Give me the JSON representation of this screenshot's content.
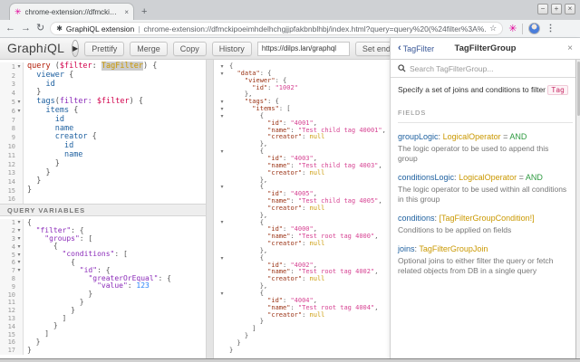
{
  "browser": {
    "tab": {
      "title": "chrome-extension://dfmckipoe",
      "close_icon": "×",
      "new_tab_icon": "+"
    },
    "window_controls": {
      "minimize": "−",
      "maximize": "+",
      "close": "×"
    },
    "nav": {
      "back_icon": "←",
      "forward_icon": "→",
      "reload_icon": "↻"
    },
    "omnibox": {
      "extension_name": "GraphiQL extension",
      "separator": "|",
      "url": "chrome-extension://dfmckipoeimhdelhchgjjpfakbnblhbj/index.html?query=query%20(%24filter%3A%...",
      "bookmark_star_icon": "☆",
      "extension_page_icon": "✱"
    },
    "extension_button_icon": "✳",
    "menu_icon": "⋮"
  },
  "toolbar": {
    "logo_graph": "Graph",
    "logo_i": "i",
    "logo_ql": "QL",
    "play_icon": "▶",
    "buttons": [
      "Prettify",
      "Merge",
      "Copy",
      "History"
    ],
    "endpoint_value": "https://dilps.lan/graphql",
    "set_endpoint_label": "Set endpoint"
  },
  "query_editor": {
    "lines": [
      {
        "n": 1,
        "f": 1,
        "t": [
          [
            "k",
            "query"
          ],
          [
            "pu",
            " ("
          ],
          [
            "v",
            "$filter"
          ],
          [
            "pu",
            ": "
          ],
          [
            "t sel",
            "TagFilter"
          ],
          [
            "pu",
            ") {"
          ]
        ]
      },
      {
        "n": 2,
        "t": [
          [
            "pu",
            "  "
          ],
          [
            "p",
            "viewer"
          ],
          [
            "pu",
            " {"
          ]
        ]
      },
      {
        "n": 3,
        "t": [
          [
            "pu",
            "    "
          ],
          [
            "p",
            "id"
          ]
        ]
      },
      {
        "n": 4,
        "t": [
          [
            "pu",
            "  }"
          ]
        ]
      },
      {
        "n": 5,
        "f": 1,
        "t": [
          [
            "pu",
            "  "
          ],
          [
            "p",
            "tags"
          ],
          [
            "pu",
            "("
          ],
          [
            "a",
            "filter:"
          ],
          [
            "pu",
            " "
          ],
          [
            "v",
            "$filter"
          ],
          [
            "pu",
            ") {"
          ]
        ]
      },
      {
        "n": 6,
        "f": 1,
        "t": [
          [
            "pu",
            "    "
          ],
          [
            "p",
            "items"
          ],
          [
            "pu",
            " {"
          ]
        ]
      },
      {
        "n": 7,
        "t": [
          [
            "pu",
            "      "
          ],
          [
            "p",
            "id"
          ]
        ]
      },
      {
        "n": 8,
        "t": [
          [
            "pu",
            "      "
          ],
          [
            "p",
            "name"
          ]
        ]
      },
      {
        "n": 9,
        "t": [
          [
            "pu",
            "      "
          ],
          [
            "p",
            "creator"
          ],
          [
            "pu",
            " {"
          ]
        ]
      },
      {
        "n": 10,
        "t": [
          [
            "pu",
            "        "
          ],
          [
            "p",
            "id"
          ]
        ]
      },
      {
        "n": 11,
        "t": [
          [
            "pu",
            "        "
          ],
          [
            "p",
            "name"
          ]
        ]
      },
      {
        "n": 12,
        "t": [
          [
            "pu",
            "      }"
          ]
        ]
      },
      {
        "n": 13,
        "t": [
          [
            "pu",
            "    }"
          ]
        ]
      },
      {
        "n": 14,
        "t": [
          [
            "pu",
            "  }"
          ]
        ]
      },
      {
        "n": 15,
        "t": [
          [
            "pu",
            "}"
          ]
        ]
      },
      {
        "n": 16,
        "t": []
      }
    ]
  },
  "variables_editor": {
    "header": "QUERY VARIABLES",
    "lines": [
      {
        "n": 1,
        "f": 1,
        "t": [
          [
            "pu",
            "{"
          ]
        ]
      },
      {
        "n": 2,
        "f": 1,
        "t": [
          [
            "pu",
            "  "
          ],
          [
            "vk",
            "\"filter\""
          ],
          [
            "pu",
            ": {"
          ]
        ]
      },
      {
        "n": 3,
        "f": 1,
        "t": [
          [
            "pu",
            "    "
          ],
          [
            "vk",
            "\"groups\""
          ],
          [
            "pu",
            ": ["
          ]
        ]
      },
      {
        "n": 4,
        "f": 1,
        "t": [
          [
            "pu",
            "      {"
          ]
        ]
      },
      {
        "n": 5,
        "f": 1,
        "t": [
          [
            "pu",
            "        "
          ],
          [
            "vk",
            "\"conditions\""
          ],
          [
            "pu",
            ": ["
          ]
        ]
      },
      {
        "n": 6,
        "f": 1,
        "t": [
          [
            "pu",
            "          {"
          ]
        ]
      },
      {
        "n": 7,
        "f": 1,
        "t": [
          [
            "pu",
            "            "
          ],
          [
            "vk",
            "\"id\""
          ],
          [
            "pu",
            ": {"
          ]
        ]
      },
      {
        "n": 8,
        "t": [
          [
            "pu",
            "              "
          ],
          [
            "vk",
            "\"greaterOrEqual\""
          ],
          [
            "pu",
            ": {"
          ]
        ]
      },
      {
        "n": 9,
        "t": [
          [
            "pu",
            "                "
          ],
          [
            "vk",
            "\"value\""
          ],
          [
            "pu",
            ": "
          ],
          [
            "num",
            "123"
          ]
        ]
      },
      {
        "n": 10,
        "t": [
          [
            "pu",
            "              }"
          ]
        ]
      },
      {
        "n": 11,
        "t": [
          [
            "pu",
            "            }"
          ]
        ]
      },
      {
        "n": 12,
        "t": [
          [
            "pu",
            "          }"
          ]
        ]
      },
      {
        "n": 13,
        "t": [
          [
            "pu",
            "        ]"
          ]
        ]
      },
      {
        "n": 14,
        "t": [
          [
            "pu",
            "      }"
          ]
        ]
      },
      {
        "n": 15,
        "t": [
          [
            "pu",
            "    ]"
          ]
        ]
      },
      {
        "n": 16,
        "t": [
          [
            "pu",
            "  }"
          ]
        ]
      },
      {
        "n": 17,
        "t": [
          [
            "pu",
            "}"
          ]
        ]
      }
    ]
  },
  "result_viewer": {
    "lines": [
      {
        "f": 1,
        "t": [
          [
            "pu",
            "{"
          ]
        ]
      },
      {
        "f": 1,
        "t": [
          [
            "pu",
            "  "
          ],
          [
            "rk",
            "\"data\""
          ],
          [
            "pu",
            ": {"
          ]
        ]
      },
      {
        "t": [
          [
            "pu",
            "    "
          ],
          [
            "rk",
            "\"viewer\""
          ],
          [
            "pu",
            ": {"
          ]
        ]
      },
      {
        "t": [
          [
            "pu",
            "      "
          ],
          [
            "rk",
            "\"id\""
          ],
          [
            "pu",
            ": "
          ],
          [
            "str",
            "\"1002\""
          ]
        ]
      },
      {
        "t": [
          [
            "pu",
            "    },"
          ]
        ]
      },
      {
        "f": 1,
        "t": [
          [
            "pu",
            "    "
          ],
          [
            "rk",
            "\"tags\""
          ],
          [
            "pu",
            ": {"
          ]
        ]
      },
      {
        "f": 1,
        "t": [
          [
            "pu",
            "      "
          ],
          [
            "rk",
            "\"items\""
          ],
          [
            "pu",
            ": ["
          ]
        ]
      },
      {
        "f": 1,
        "t": [
          [
            "pu",
            "        {"
          ]
        ]
      },
      {
        "t": [
          [
            "pu",
            "          "
          ],
          [
            "rk",
            "\"id\""
          ],
          [
            "pu",
            ": "
          ],
          [
            "str",
            "\"4001\""
          ],
          [
            "pu",
            ","
          ]
        ]
      },
      {
        "t": [
          [
            "pu",
            "          "
          ],
          [
            "rk",
            "\"name\""
          ],
          [
            "pu",
            ": "
          ],
          [
            "str",
            "\"Test child tag 40001\""
          ],
          [
            "pu",
            ","
          ]
        ]
      },
      {
        "t": [
          [
            "pu",
            "          "
          ],
          [
            "rk",
            "\"creator\""
          ],
          [
            "pu",
            ": "
          ],
          [
            "nul",
            "null"
          ]
        ]
      },
      {
        "t": [
          [
            "pu",
            "        },"
          ]
        ]
      },
      {
        "f": 1,
        "t": [
          [
            "pu",
            "        {"
          ]
        ]
      },
      {
        "t": [
          [
            "pu",
            "          "
          ],
          [
            "rk",
            "\"id\""
          ],
          [
            "pu",
            ": "
          ],
          [
            "str",
            "\"4003\""
          ],
          [
            "pu",
            ","
          ]
        ]
      },
      {
        "t": [
          [
            "pu",
            "          "
          ],
          [
            "rk",
            "\"name\""
          ],
          [
            "pu",
            ": "
          ],
          [
            "str",
            "\"Test child tag 4003\""
          ],
          [
            "pu",
            ","
          ]
        ]
      },
      {
        "t": [
          [
            "pu",
            "          "
          ],
          [
            "rk",
            "\"creator\""
          ],
          [
            "pu",
            ": "
          ],
          [
            "nul",
            "null"
          ]
        ]
      },
      {
        "t": [
          [
            "pu",
            "        },"
          ]
        ]
      },
      {
        "f": 1,
        "t": [
          [
            "pu",
            "        {"
          ]
        ]
      },
      {
        "t": [
          [
            "pu",
            "          "
          ],
          [
            "rk",
            "\"id\""
          ],
          [
            "pu",
            ": "
          ],
          [
            "str",
            "\"4005\""
          ],
          [
            "pu",
            ","
          ]
        ]
      },
      {
        "t": [
          [
            "pu",
            "          "
          ],
          [
            "rk",
            "\"name\""
          ],
          [
            "pu",
            ": "
          ],
          [
            "str",
            "\"Test child tag 4005\""
          ],
          [
            "pu",
            ","
          ]
        ]
      },
      {
        "t": [
          [
            "pu",
            "          "
          ],
          [
            "rk",
            "\"creator\""
          ],
          [
            "pu",
            ": "
          ],
          [
            "nul",
            "null"
          ]
        ]
      },
      {
        "t": [
          [
            "pu",
            "        },"
          ]
        ]
      },
      {
        "f": 1,
        "t": [
          [
            "pu",
            "        {"
          ]
        ]
      },
      {
        "t": [
          [
            "pu",
            "          "
          ],
          [
            "rk",
            "\"id\""
          ],
          [
            "pu",
            ": "
          ],
          [
            "str",
            "\"4000\""
          ],
          [
            "pu",
            ","
          ]
        ]
      },
      {
        "t": [
          [
            "pu",
            "          "
          ],
          [
            "rk",
            "\"name\""
          ],
          [
            "pu",
            ": "
          ],
          [
            "str",
            "\"Test root tag 4000\""
          ],
          [
            "pu",
            ","
          ]
        ]
      },
      {
        "t": [
          [
            "pu",
            "          "
          ],
          [
            "rk",
            "\"creator\""
          ],
          [
            "pu",
            ": "
          ],
          [
            "nul",
            "null"
          ]
        ]
      },
      {
        "t": [
          [
            "pu",
            "        },"
          ]
        ]
      },
      {
        "f": 1,
        "t": [
          [
            "pu",
            "        {"
          ]
        ]
      },
      {
        "t": [
          [
            "pu",
            "          "
          ],
          [
            "rk",
            "\"id\""
          ],
          [
            "pu",
            ": "
          ],
          [
            "str",
            "\"4002\""
          ],
          [
            "pu",
            ","
          ]
        ]
      },
      {
        "t": [
          [
            "pu",
            "          "
          ],
          [
            "rk",
            "\"name\""
          ],
          [
            "pu",
            ": "
          ],
          [
            "str",
            "\"Test root tag 4002\""
          ],
          [
            "pu",
            ","
          ]
        ]
      },
      {
        "t": [
          [
            "pu",
            "          "
          ],
          [
            "rk",
            "\"creator\""
          ],
          [
            "pu",
            ": "
          ],
          [
            "nul",
            "null"
          ]
        ]
      },
      {
        "t": [
          [
            "pu",
            "        },"
          ]
        ]
      },
      {
        "f": 1,
        "t": [
          [
            "pu",
            "        {"
          ]
        ]
      },
      {
        "t": [
          [
            "pu",
            "          "
          ],
          [
            "rk",
            "\"id\""
          ],
          [
            "pu",
            ": "
          ],
          [
            "str",
            "\"4004\""
          ],
          [
            "pu",
            ","
          ]
        ]
      },
      {
        "t": [
          [
            "pu",
            "          "
          ],
          [
            "rk",
            "\"name\""
          ],
          [
            "pu",
            ": "
          ],
          [
            "str",
            "\"Test root tag 4004\""
          ],
          [
            "pu",
            ","
          ]
        ]
      },
      {
        "t": [
          [
            "pu",
            "          "
          ],
          [
            "rk",
            "\"creator\""
          ],
          [
            "pu",
            ": "
          ],
          [
            "nul",
            "null"
          ]
        ]
      },
      {
        "t": [
          [
            "pu",
            "        }"
          ]
        ]
      },
      {
        "t": [
          [
            "pu",
            "      ]"
          ]
        ]
      },
      {
        "t": [
          [
            "pu",
            "    }"
          ]
        ]
      },
      {
        "t": [
          [
            "pu",
            "  }"
          ]
        ]
      },
      {
        "t": [
          [
            "pu",
            "}"
          ]
        ]
      }
    ]
  },
  "docs": {
    "back_label": "TagFilter",
    "back_chevron": "‹",
    "title": "TagFilterGroup",
    "close_icon": "×",
    "search_placeholder": "Search TagFilterGroup...",
    "description_prefix": "Specify a set of joins and conditions to filter ",
    "description_code": "Tag",
    "fields_label": "FIELDS",
    "fields": [
      {
        "name": "groupLogic",
        "type": "LogicalOperator",
        "default": "AND",
        "desc": "The logic operator to be used to append this group"
      },
      {
        "name": "conditionsLogic",
        "type": "LogicalOperator",
        "default": "AND",
        "desc": "The logic operator to be used within all conditions in this group"
      },
      {
        "name": "conditions",
        "type": "[TagFilterGroupCondition!]",
        "default": null,
        "desc": "Conditions to be applied on fields"
      },
      {
        "name": "joins",
        "type": "TagFilterGroupJoin",
        "default": null,
        "desc": "Optional joins to either filter the query or fetch related objects from DB in a single query"
      }
    ]
  },
  "colors": {
    "brand_magenta": "#E10098",
    "keyword": "#B11A04",
    "variable": "#D2054E",
    "argument": "#8B2BB9",
    "type": "#CA9800",
    "field": "#1F61A0",
    "string_value": "#D64292",
    "number": "#2882F9",
    "default_value_green": "#2E9A40",
    "doc_link_blue": "#3B5998"
  }
}
